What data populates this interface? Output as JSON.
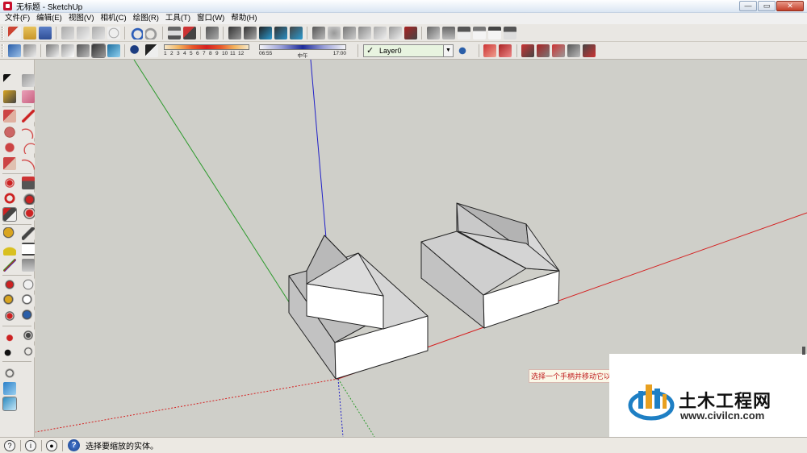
{
  "window": {
    "title": "无标题 - SketchUp",
    "controls": [
      "—",
      "▭",
      "✕"
    ]
  },
  "menu": [
    "文件(F)",
    "编辑(E)",
    "视图(V)",
    "相机(C)",
    "绘图(R)",
    "工具(T)",
    "窗口(W)",
    "帮助(H)"
  ],
  "shadow_months": {
    "labels": [
      "1",
      "2",
      "3",
      "4",
      "5",
      "6",
      "7",
      "8",
      "9",
      "10",
      "11",
      "12"
    ]
  },
  "shadow_time": {
    "start": "06:55",
    "mid": "中午",
    "end": "17:00"
  },
  "layer": {
    "checked": "✓",
    "name": "Layer0"
  },
  "viewport": {
    "tooltip": "选择一个手柄并移动它以调",
    "background": "#cfcfc9",
    "axis_colors": {
      "red": "#d42020",
      "green": "#2c9a2c",
      "blue": "#2020c8"
    }
  },
  "watermark": {
    "name": "土木工程网",
    "url": "www.civilcn.com"
  },
  "status": {
    "icon1": "?",
    "icon2": "i",
    "icon3": "●",
    "help": "?",
    "text": "选择要缩放的实体。"
  }
}
